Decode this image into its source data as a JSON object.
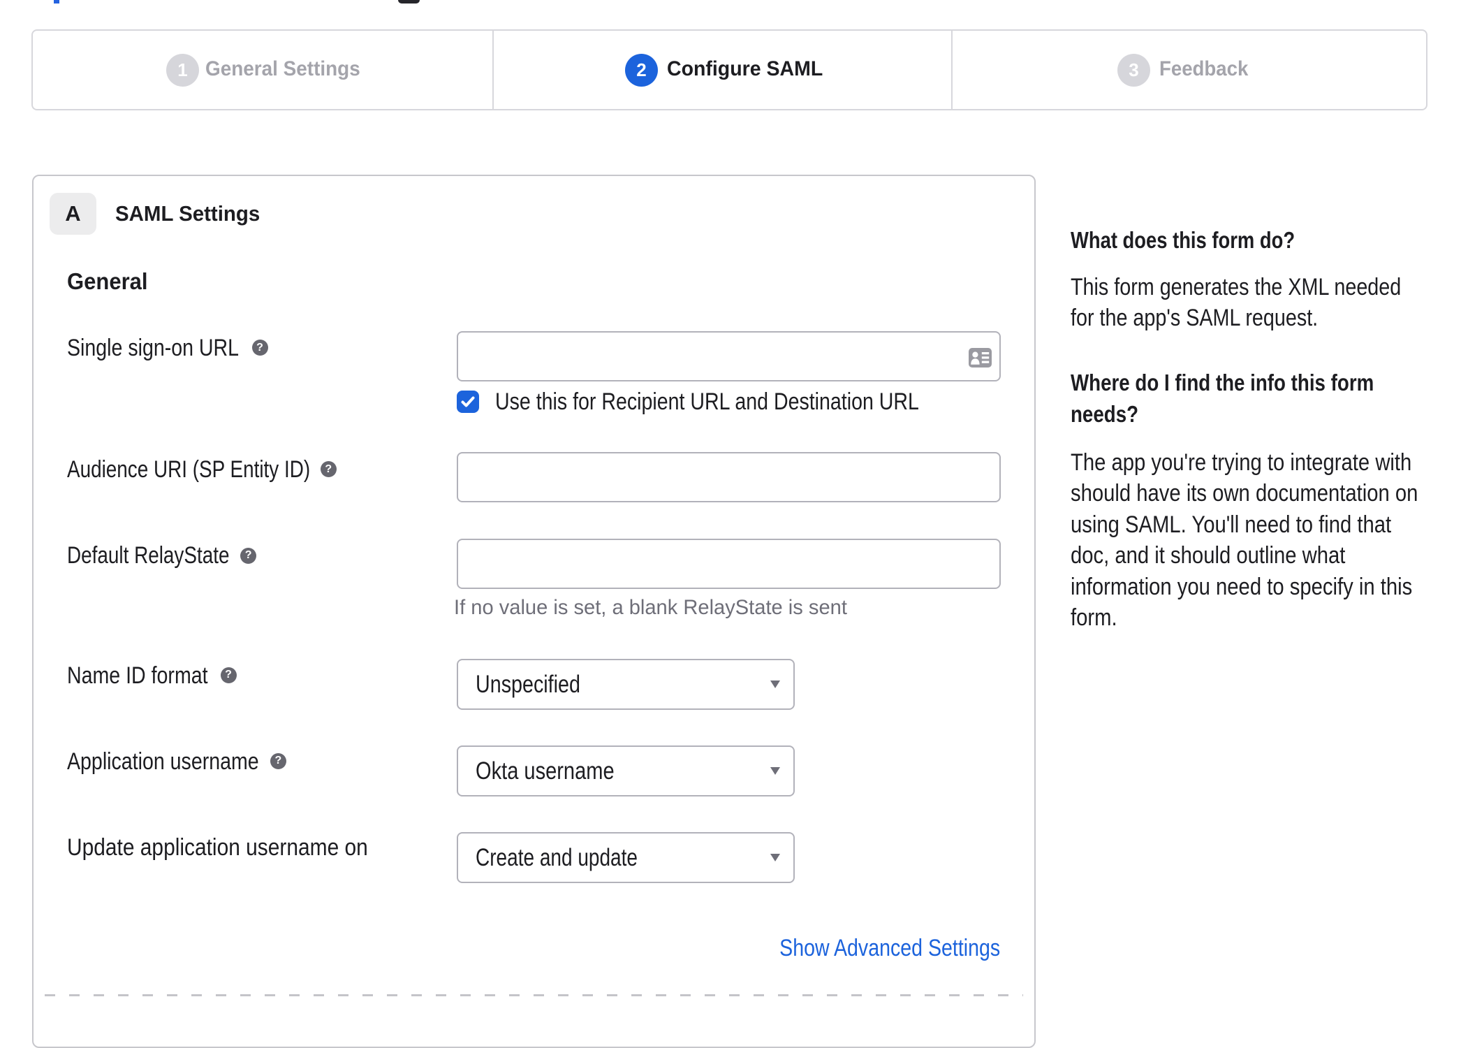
{
  "colors": {
    "primary_blue": "#1c63dc",
    "text_dark": "#1d1d21",
    "text_muted": "#6e6e78",
    "inactive_step": "#a4a4ab",
    "input_border": "#b2b2ba"
  },
  "stepper": {
    "steps": [
      {
        "number": "1",
        "label": "General Settings",
        "active": false
      },
      {
        "number": "2",
        "label": "Configure SAML",
        "active": true
      },
      {
        "number": "3",
        "label": "Feedback",
        "active": false
      }
    ]
  },
  "card": {
    "section_badge": "A",
    "section_title": "SAML Settings",
    "group_heading": "General",
    "help_icon_char": "?",
    "fields": [
      {
        "label": "Single sign-on URL",
        "type": "text",
        "value": "",
        "checkbox_label": "Use this for Recipient URL and Destination URL",
        "checkbox_checked": true
      },
      {
        "label": "Audience URI (SP Entity ID)",
        "type": "text",
        "value": ""
      },
      {
        "label": "Default RelayState",
        "type": "text",
        "value": "",
        "hint": "If no value is set, a blank RelayState is sent"
      },
      {
        "label": "Name ID format",
        "type": "select",
        "value": "Unspecified"
      },
      {
        "label": "Application username",
        "type": "select",
        "value": "Okta username"
      },
      {
        "label": "Update application username on",
        "type": "select",
        "value": "Create and update"
      }
    ],
    "advanced_link": "Show Advanced Settings"
  },
  "help_panel": {
    "sections": [
      {
        "heading": "What does this form do?",
        "body": [
          "This form generates the XML needed",
          "for the app's SAML request."
        ]
      },
      {
        "heading": [
          "Where do I find the info this form",
          "needs?"
        ],
        "body": [
          "The app you're trying to integrate with",
          "should have its own documentation on",
          "using SAML. You'll need to find that",
          "doc, and it should outline what",
          "information you need to specify in this",
          "form."
        ]
      }
    ]
  }
}
